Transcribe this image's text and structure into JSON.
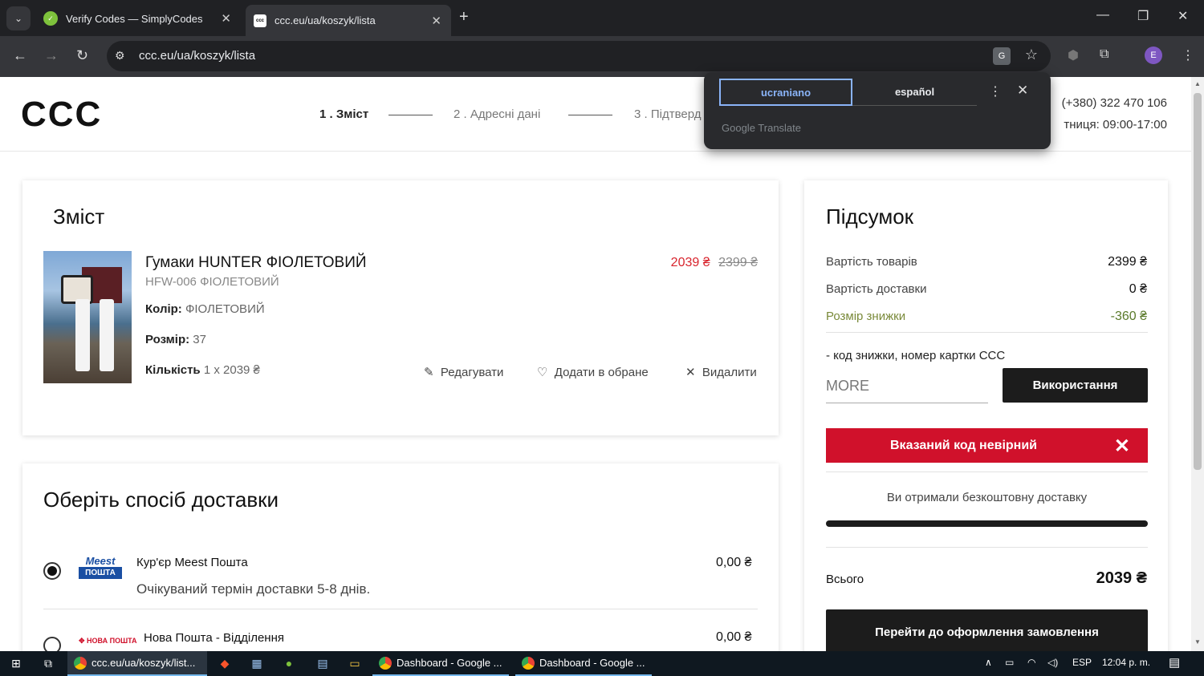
{
  "browser": {
    "tabs": [
      {
        "title": "Verify Codes — SimplyCodes",
        "active": false
      },
      {
        "title": "ccc.eu/ua/koszyk/lista",
        "active": true
      }
    ],
    "url": "ccc.eu/ua/koszyk/lista",
    "profile_initial": "E",
    "favicon_ccc_text": "ccc"
  },
  "translate_popup": {
    "source_lang": "ucraniano",
    "target_lang": "español",
    "brand": "Google Translate"
  },
  "site": {
    "logo": "CCC",
    "steps": [
      {
        "label": "1 . Зміст",
        "active": true
      },
      {
        "label": "2 . Адресні дані",
        "active": false
      },
      {
        "label": "3 . Підтверд",
        "active": false
      }
    ],
    "phone": "(+380) 322 470 106",
    "hours": "тниця: 09:00-17:00"
  },
  "cart": {
    "heading": "Зміст",
    "product": {
      "name": "Гумаки HUNTER ФІОЛЕТОВИЙ",
      "sku": "HFW-006 ФІОЛЕТОВИЙ",
      "price_new": "2039 ₴",
      "price_old": "2399 ₴",
      "color_label": "Колір:",
      "color_value": "ФІОЛЕТОВИЙ",
      "size_label": "Розмір:",
      "size_value": "37",
      "qty_label": "Кількість",
      "qty_value": "1 x 2039 ₴",
      "edit": "Редагувати",
      "favorite": "Додати в обране",
      "remove": "Видалити"
    }
  },
  "shipping": {
    "heading": "Оберіть спосіб доставки",
    "options": [
      {
        "logo_top": "Meest",
        "logo_bottom": "ПОШТА",
        "name": "Кур'єр Meest Пошта",
        "sub": "Очікуваний термін доставки 5-8 днів.",
        "price": "0,00 ₴",
        "selected": true
      },
      {
        "logo_top": "НОВА ПОШТА",
        "name": "Нова Пошта - Відділення",
        "price": "0,00 ₴",
        "selected": false
      }
    ]
  },
  "summary": {
    "heading": "Підсумок",
    "rows": [
      {
        "label": "Вартість товарів",
        "value": "2399 ₴"
      },
      {
        "label": "Вартість доставки",
        "value": "0 ₴"
      },
      {
        "label": "Розмір знижки",
        "value": "-360 ₴"
      }
    ],
    "promo_label": "- код знижки, номер картки CCC",
    "promo_value": "MORE",
    "apply_button": "Використання",
    "error_message": "Вказаний код невірний",
    "free_shipping_text": "Ви отримали безкоштовну доставку",
    "free_shipping_progress": 1.0,
    "total_label": "Всього",
    "total_value": "2039 ₴",
    "checkout_button": "Перейти до оформлення замовлення"
  },
  "taskbar": {
    "apps": [
      {
        "title": "ccc.eu/ua/koszyk/list...",
        "focused": true
      },
      {
        "title": "Dashboard - Google ...",
        "focused": false
      },
      {
        "title": "Dashboard - Google ...",
        "focused": false
      }
    ],
    "lang": "ESP",
    "time": "12:04 p. m."
  }
}
